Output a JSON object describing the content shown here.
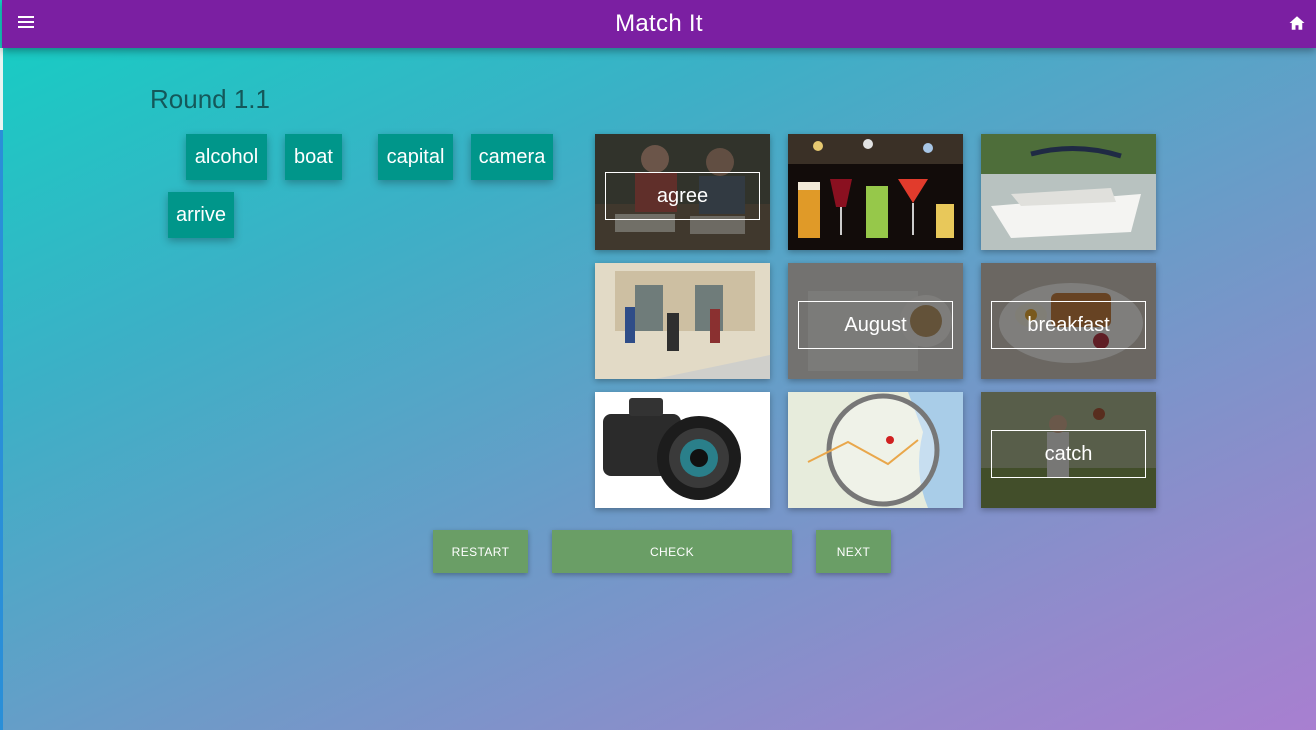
{
  "header": {
    "title": "Match It",
    "menu_icon": "hamburger-menu-icon",
    "home_icon": "home-icon",
    "bar_color": "#7b1fa2"
  },
  "round": {
    "title": "Round 1.1"
  },
  "words": [
    "alcohol",
    "boat",
    "capital",
    "camera",
    "arrive"
  ],
  "tiles": [
    {
      "image": "students-studying",
      "label": "agree"
    },
    {
      "image": "drinks",
      "label": ""
    },
    {
      "image": "speedboat",
      "label": ""
    },
    {
      "image": "students-arriving",
      "label": ""
    },
    {
      "image": "calendar-coffee",
      "label": "August"
    },
    {
      "image": "breakfast-plate",
      "label": "breakfast"
    },
    {
      "image": "camera",
      "label": ""
    },
    {
      "image": "map-magnifier",
      "label": ""
    },
    {
      "image": "ball-catch",
      "label": "catch"
    }
  ],
  "buttons": {
    "restart": "RESTART",
    "check": "CHECK",
    "next": "NEXT"
  },
  "colors": {
    "chip": "#00968a",
    "button": "#6a9e66"
  }
}
